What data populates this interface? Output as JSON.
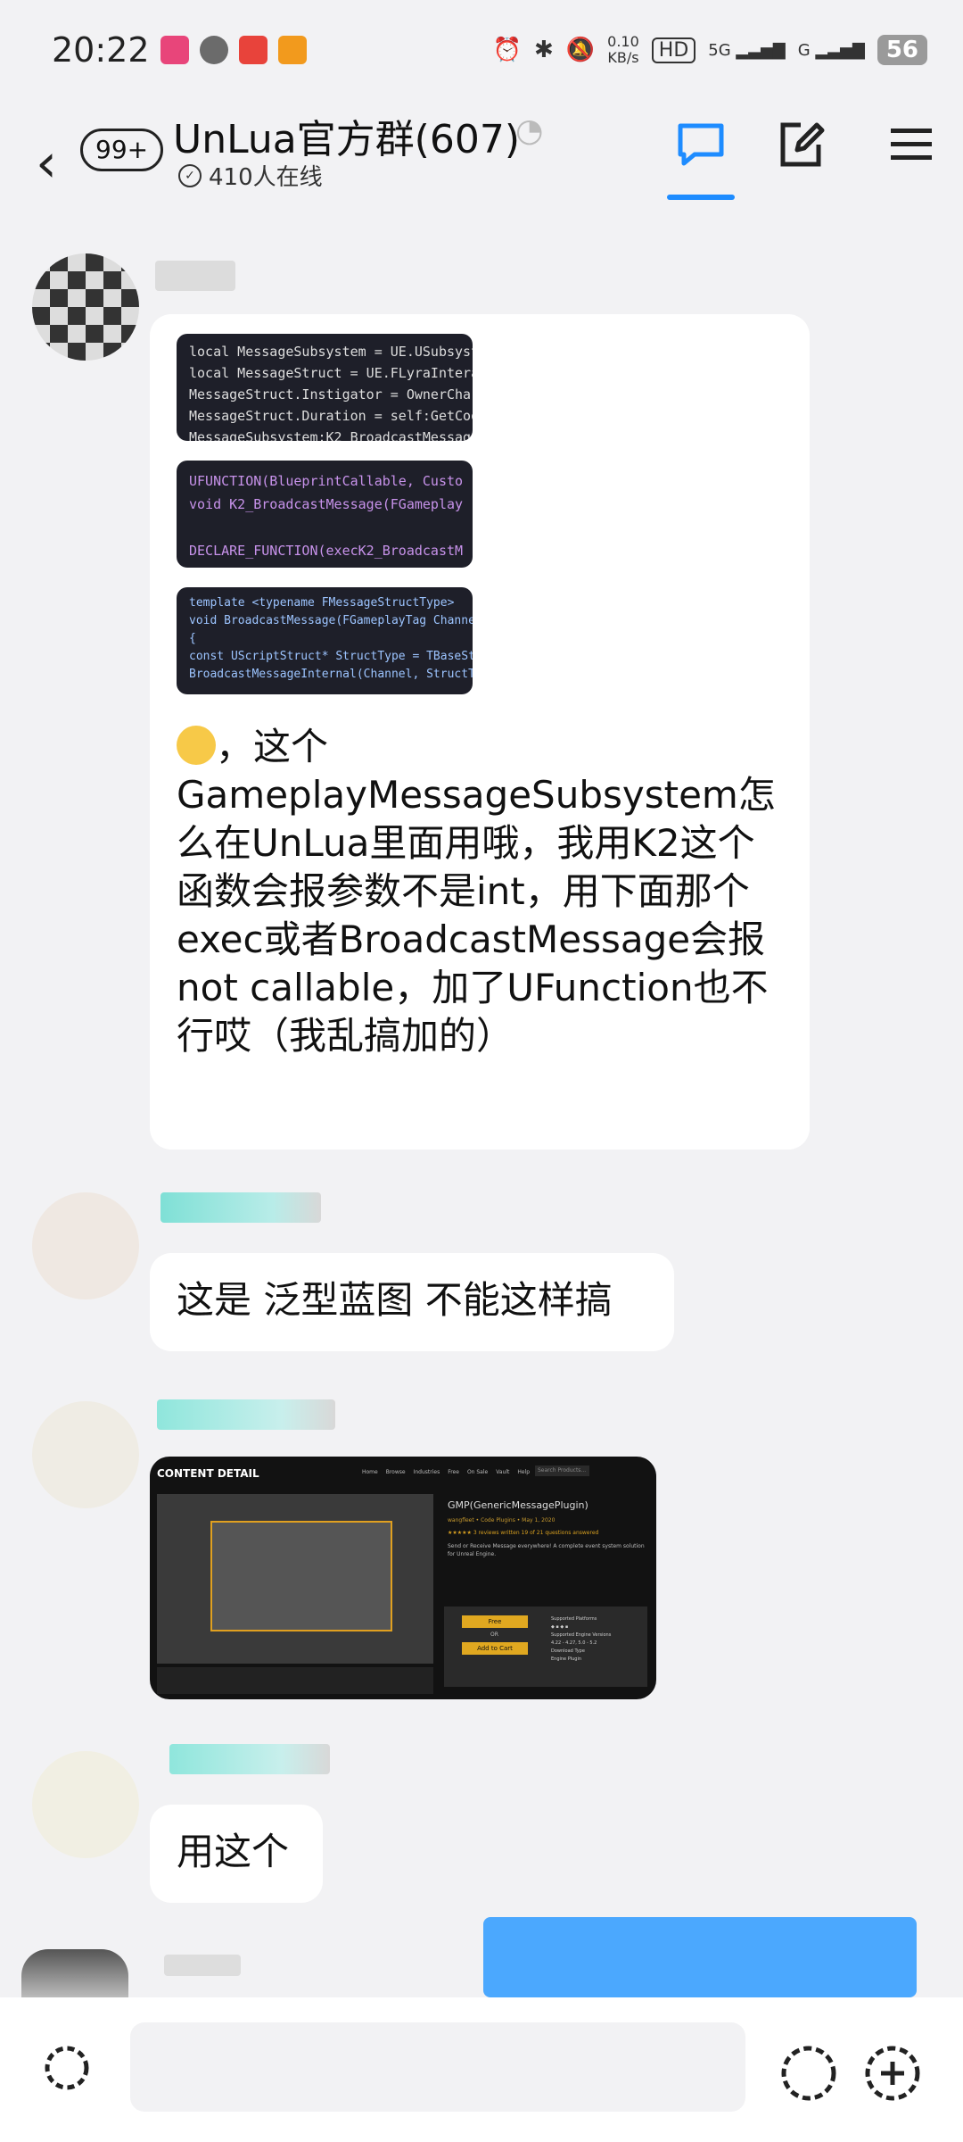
{
  "status_bar": {
    "time": "20:22",
    "net_speed_top": "0.10",
    "net_speed_bottom": "KB/s",
    "hd": "HD",
    "sim1": "5G",
    "sim2": "G",
    "battery": "56"
  },
  "header": {
    "unread_badge": "99+",
    "title": "UnLua官方群(607)",
    "online": "410人在线"
  },
  "messages": [
    {
      "type": "images_text",
      "code_images": [
        [
          "local MessageSubsystem = UE.USubsyst",
          "local MessageStruct = UE.FLyraIntera",
          "MessageStruct.Instigator = OwnerChar",
          "MessageStruct.Duration = self:GetCoo",
          "MessageSubsystem:K2_BroadcastMessage"
        ],
        [
          "UFUNCTION(BlueprintCallable, Custo",
          "void K2_BroadcastMessage(FGameplay",
          "",
          "DECLARE_FUNCTION(execK2_BroadcastM"
        ],
        [
          "template <typename FMessageStructType>",
          "void BroadcastMessage(FGameplayTag Channel, co",
          "{",
          "    const UScriptStruct* StructType = TBaseStr",
          "    BroadcastMessageInternal(Channel, StructTy"
        ]
      ],
      "text": "，这个GameplayMessageSubsystem怎么在UnLua里面用哦，我用K2这个函数会报参数不是int，用下面那个exec或者BroadcastMessage会报not callable，加了UFunction也不行哎（我乱搞加的）"
    },
    {
      "type": "text",
      "text": "这是 泛型蓝图 不能这样搞"
    },
    {
      "type": "image",
      "header_label": "CONTENT DETAIL",
      "nav": [
        "Home",
        "Browse",
        "Industries",
        "Free",
        "On Sale",
        "Vault",
        "Help"
      ],
      "search_placeholder": "Search Products...",
      "product_title": "GMP(GenericMessagePlugin)",
      "product_meta": "wangfleet • Code Plugins • May 1, 2020",
      "rating_text": "3 reviews written   19 of 21 questions answered",
      "description": "Send or Receive Message everywhere! A complete event system solution for Unreal Engine.",
      "price_label": "Free",
      "or_label": "OR",
      "add_cart_label": "Add to Cart",
      "platforms_label": "Supported Platforms",
      "engine_label": "Supported Engine Versions",
      "engine_versions": "4.22 - 4.27, 5.0 - 5.2",
      "download_type_label": "Download Type",
      "download_type": "Engine Plugin"
    },
    {
      "type": "text",
      "text": "用这个"
    }
  ],
  "colors": {
    "accent": "#1e8cff",
    "bubble": "#ffffff",
    "background": "#f2f2f4",
    "own_bubble": "#2e9bff"
  }
}
